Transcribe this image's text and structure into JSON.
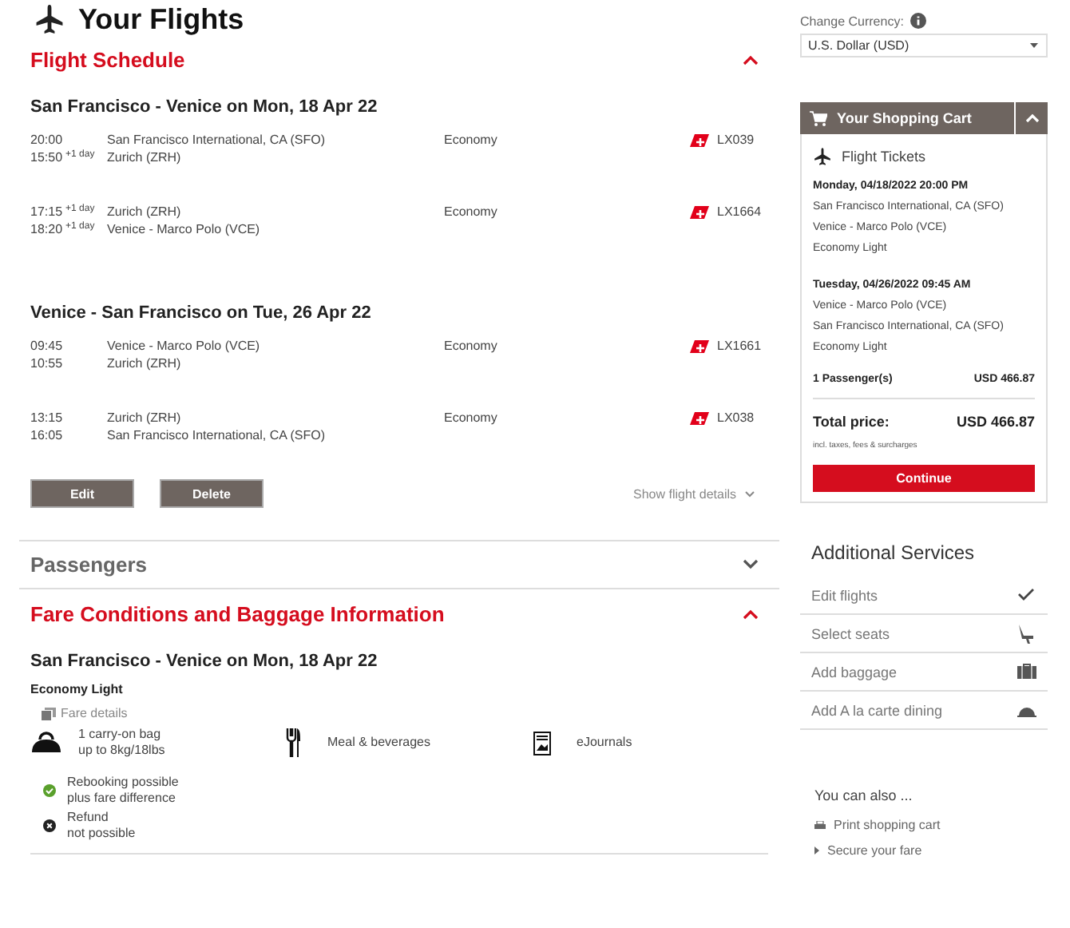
{
  "header": {
    "title": "Your Flights"
  },
  "sections": [
    {
      "kind": "schedule",
      "title": "Flight Schedule",
      "expanded": true,
      "journeys": [
        {
          "title": "San Francisco - Venice on Mon, 18 Apr 22",
          "flights": [
            {
              "dep_time": "20:00",
              "arr_time": "15:50",
              "arr_offset": "+1 day",
              "from": "San Francisco International, CA (SFO)",
              "to": "Zurich (ZRH)",
              "cabin": "Economy",
              "flight_number": "LX039"
            },
            {
              "dep_time": "17:15",
              "dep_offset": "+1 day",
              "arr_time": "18:20",
              "arr_offset": "+1 day",
              "from": "Zurich (ZRH)",
              "to": "Venice - Marco Polo (VCE)",
              "cabin": "Economy",
              "flight_number": "LX1664"
            }
          ]
        },
        {
          "title": "Venice - San Francisco on Tue, 26 Apr 22",
          "flights": [
            {
              "dep_time": "09:45",
              "arr_time": "10:55",
              "from": "Venice - Marco Polo (VCE)",
              "to": "Zurich (ZRH)",
              "cabin": "Economy",
              "flight_number": "LX1661"
            },
            {
              "dep_time": "13:15",
              "arr_time": "16:05",
              "from": "Zurich (ZRH)",
              "to": "San Francisco International, CA (SFO)",
              "cabin": "Economy",
              "flight_number": "LX038"
            }
          ]
        }
      ],
      "buttons": [
        "Edit",
        "Delete"
      ],
      "details_link": "Show flight details"
    },
    {
      "kind": "passengers",
      "title": "Passengers",
      "expanded": false
    },
    {
      "kind": "fare",
      "title": "Fare Conditions and Baggage Information",
      "expanded": true,
      "journey": "San Francisco - Venice on Mon, 18 Apr 22",
      "fare_name": "Economy Light",
      "details_link": "Fare details",
      "features": [
        {
          "kind": "bag",
          "lines": [
            "1 carry-on bag",
            "up to 8kg/18lbs"
          ]
        },
        {
          "kind": "meal",
          "lines": [
            "Meal & beverages"
          ]
        },
        {
          "kind": "journal",
          "lines": [
            "eJournals"
          ]
        }
      ],
      "conditions": [
        {
          "allowed": true,
          "lines": [
            "Rebooking possible",
            "plus fare difference"
          ]
        },
        {
          "allowed": false,
          "lines": [
            "Refund",
            "not possible"
          ]
        }
      ]
    }
  ],
  "currency": {
    "label": "Change Currency:",
    "value": "U.S. Dollar (USD)"
  },
  "cart": {
    "title": "Your Shopping Cart",
    "expanded": true,
    "section_title": "Flight Tickets",
    "trips": [
      {
        "date": "Monday, 04/18/2022 20:00 PM",
        "lines": [
          "San Francisco International, CA (SFO)",
          "Venice - Marco Polo (VCE)",
          "Economy Light"
        ]
      },
      {
        "date": "Tuesday, 04/26/2022 09:45 AM",
        "lines": [
          "Venice - Marco Polo (VCE)",
          "San Francisco International, CA (SFO)",
          "Economy Light"
        ]
      }
    ],
    "passengers_label": "1 Passenger(s)",
    "passengers_price": "USD 466.87",
    "total_label": "Total price:",
    "total_price": "USD 466.87",
    "note": "incl. taxes, fees & surcharges",
    "button": "Continue"
  },
  "services": {
    "title": "Additional Services",
    "items": [
      {
        "label": "Edit flights",
        "kind": "check"
      },
      {
        "label": "Select seats",
        "kind": "seat"
      },
      {
        "label": "Add baggage",
        "kind": "suitcase"
      },
      {
        "label": "Add A la carte dining",
        "kind": "cloche"
      }
    ]
  },
  "also": {
    "title": "You can also ...",
    "links": [
      {
        "kind": "print",
        "label": "Print shopping cart"
      },
      {
        "kind": "arrow",
        "label": "Secure your fare"
      }
    ]
  }
}
